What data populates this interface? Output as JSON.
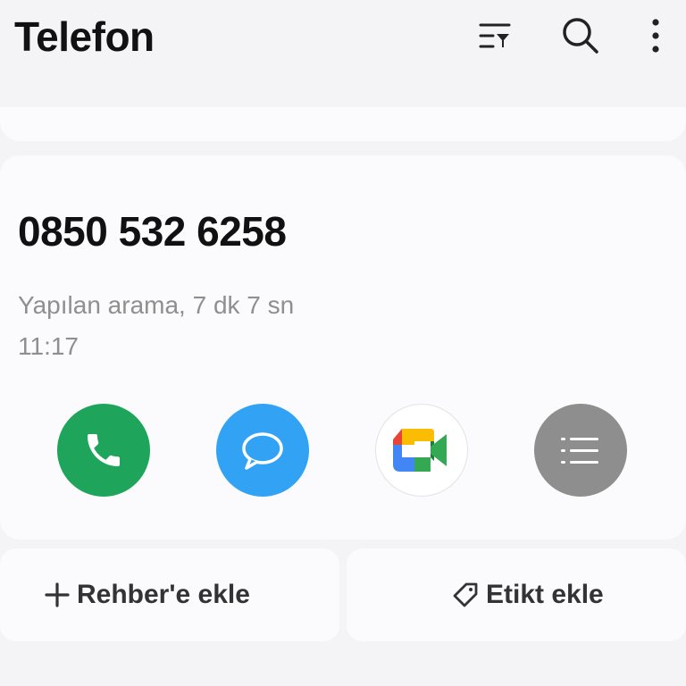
{
  "header": {
    "title": "Telefon",
    "icons": [
      "filter-icon",
      "search-icon",
      "more-vertical-icon"
    ]
  },
  "call_card": {
    "number": "0850 532 6258",
    "call_type_duration": "Yapılan arama, 7 dk 7 sn",
    "time": "11:17",
    "actions": [
      {
        "name": "call-button",
        "icon": "phone-icon",
        "color": "#1fa55b"
      },
      {
        "name": "message-button",
        "icon": "message-bubble-icon",
        "color": "#31a2f4"
      },
      {
        "name": "video-call-button",
        "icon": "google-meet-icon",
        "color": "#ffffff"
      },
      {
        "name": "details-button",
        "icon": "list-icon",
        "color": "#8e8e8e"
      }
    ]
  },
  "bottom_actions": {
    "add_contact_label": "Rehber'e ekle",
    "add_tag_label": "Etikt ekle"
  }
}
